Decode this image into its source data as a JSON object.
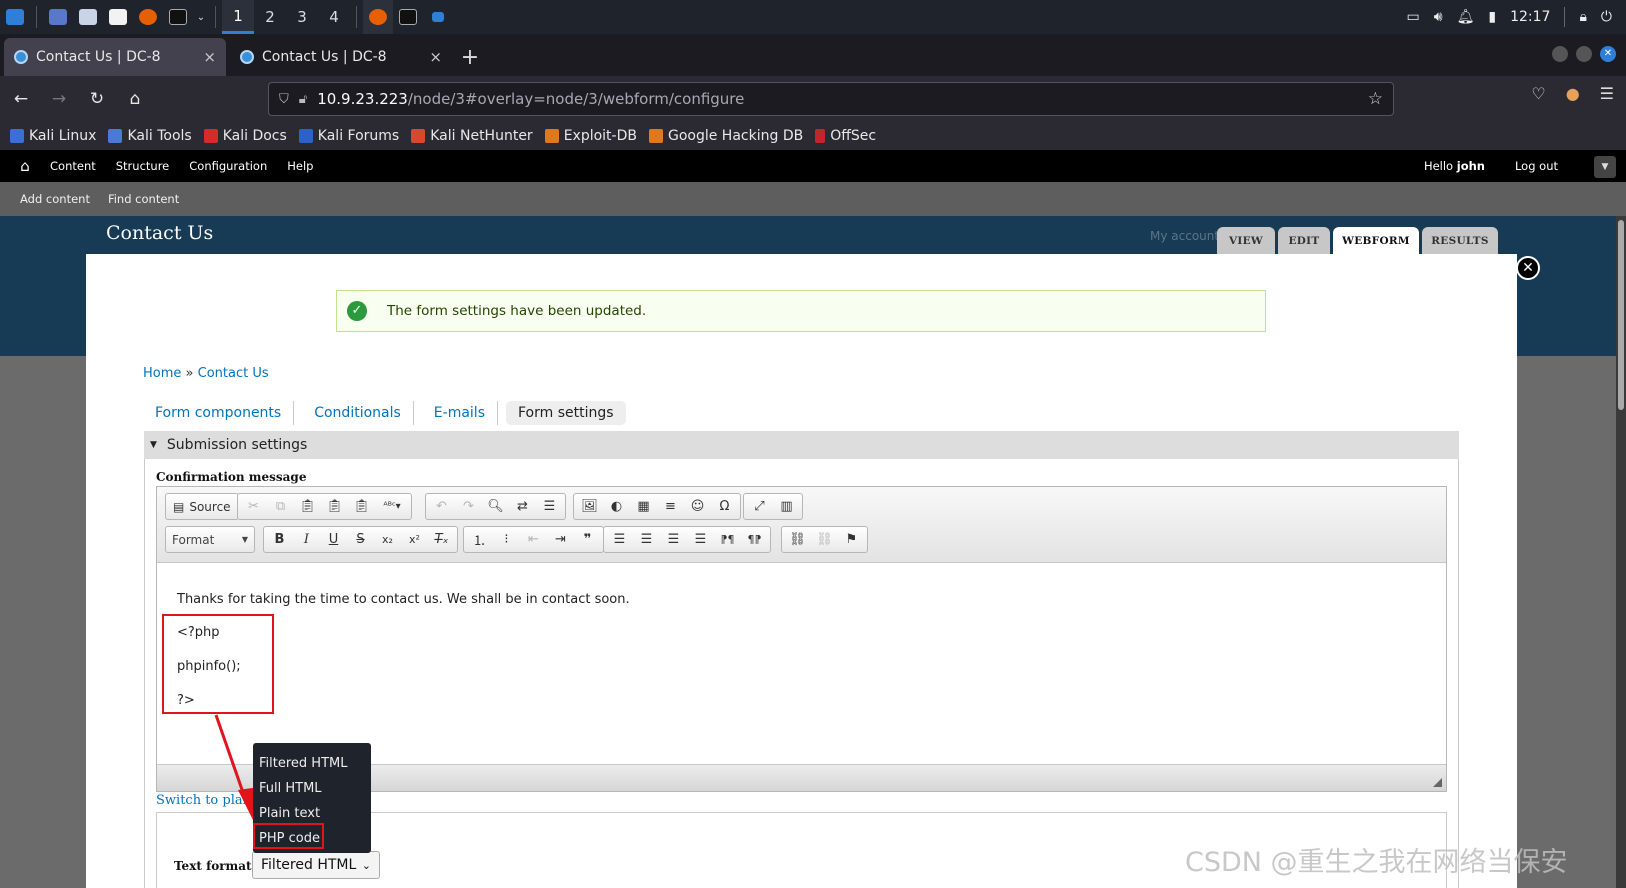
{
  "panel": {
    "workspaces": [
      "1",
      "2",
      "3",
      "4"
    ],
    "clock": "12:17"
  },
  "browser": {
    "tabs": [
      {
        "title": "Contact Us | DC-8",
        "close": "×"
      },
      {
        "title": "Contact Us | DC-8",
        "close": "×"
      }
    ],
    "new_tab": "+",
    "url_host": "10.9.23.223",
    "url_path": "/node/3#overlay=node/3/webform/configure"
  },
  "bookmarks": [
    {
      "label": "Kali Linux",
      "color": "#3a6fd6"
    },
    {
      "label": "Kali Tools",
      "color": "#4a7ad8"
    },
    {
      "label": "Kali Docs",
      "color": "#d42b2b"
    },
    {
      "label": "Kali Forums",
      "color": "#2b61c9"
    },
    {
      "label": "Kali NetHunter",
      "color": "#d44a2b"
    },
    {
      "label": "Exploit-DB",
      "color": "#e0781e"
    },
    {
      "label": "Google Hacking DB",
      "color": "#e0781e"
    },
    {
      "label": "OffSec",
      "color": "#c0262b"
    }
  ],
  "drupal_toolbar": {
    "menu": [
      "Content",
      "Structure",
      "Configuration",
      "Help"
    ],
    "hello_prefix": "Hello ",
    "user": "john",
    "logout": "Log out",
    "shortcuts": [
      "Add content",
      "Find content"
    ]
  },
  "site": {
    "title": "Contact Us",
    "my_account": "My account",
    "tabs": [
      "VIEW",
      "EDIT",
      "WEBFORM",
      "RESULTS"
    ],
    "active_tab": "WEBFORM"
  },
  "overlay": {
    "status_message": "The form settings have been updated.",
    "breadcrumb": [
      "Home",
      "Contact Us"
    ],
    "breadcrumb_sep": "»",
    "subtabs": [
      "Form components",
      "Conditionals",
      "E-mails",
      "Form settings"
    ],
    "active_subtab": "Form settings",
    "fieldset_legend": "Submission settings",
    "confirmation_label": "Confirmation message",
    "editor": {
      "source_label": "Source",
      "format_label": "Format",
      "content": [
        "Thanks for taking the time to contact us. We shall be in contact soon.",
        "<?php",
        "phpinfo();",
        "?>"
      ]
    },
    "switch_link": "Switch to plain",
    "text_format_label": "Text format",
    "text_format_value": "Filtered HTML",
    "text_format_options": [
      "Filtered HTML",
      "Full HTML",
      "Plain text",
      "PHP code"
    ],
    "highlighted_option": "PHP code"
  },
  "watermark": "CSDN @重生之我在网络当保安",
  "colors": {
    "annotation_red": "#e0141e",
    "link_blue": "#0074bd",
    "header_navy": "#173a55"
  }
}
